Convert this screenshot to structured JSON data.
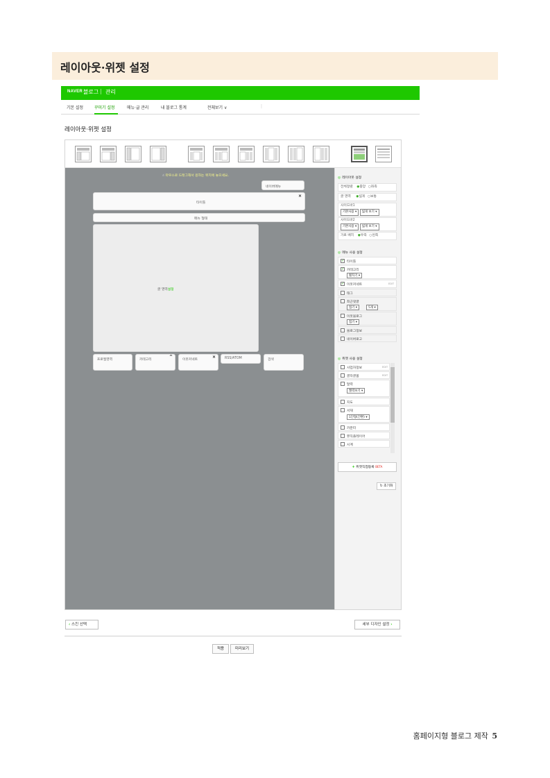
{
  "page_header": {
    "title": "레이아웃·위젯 설정"
  },
  "nav": {
    "brand": "NAVER",
    "blog": "블로그",
    "separator": "|",
    "admin": "관리"
  },
  "tabs": [
    {
      "label": "기본 설정"
    },
    {
      "label": "꾸미기 설정"
    },
    {
      "label": "메뉴·글 관리"
    },
    {
      "label": "내 블로그 통계"
    },
    {
      "label": "전체보기 ∨"
    }
  ],
  "section_title": "레이아웃·위젯 설정",
  "canvas": {
    "hint": "마우스로 드래그해서 원하는 위치에 놓으세요.",
    "blocks": {
      "network_menu": "네이버메뉴",
      "title": "타이틀",
      "menu_bar": "메뉴 형태",
      "post_area": "글 영역",
      "post_area_accent": "설정",
      "profile": "프로필영역",
      "category": "카테고리",
      "neighbor": "이웃커넥트",
      "rss": "RSS/ATOM",
      "search": "검색"
    }
  },
  "sidebar": {
    "layout_settings": {
      "heading": "레이아웃 설정",
      "rows": [
        {
          "label": "전체정렬",
          "opt_on": "중앙",
          "opt_off": "좌측"
        },
        {
          "label": "글 영역",
          "opt_on": "넓게",
          "opt_off": "보통"
        },
        {
          "label": "사이드바1",
          "sel1": "기본사용",
          "sel2": "넓게 보기"
        },
        {
          "label": "사이드바2",
          "sel1": "기본사용",
          "sel2": "넓게 보기"
        },
        {
          "label": "가로 배치",
          "opt_on": "우측",
          "opt_off": "왼쪽"
        }
      ]
    },
    "menu_settings": {
      "heading": "메뉴 사용 설정",
      "items": [
        {
          "label": "타이틀",
          "checked": true
        },
        {
          "label": "카테고리",
          "sub": "펼치기",
          "checked": true
        },
        {
          "label": "이웃커넥트",
          "edit": "EDIT",
          "checked": true
        },
        {
          "label": "태그",
          "checked": false
        },
        {
          "label": "최근댓글",
          "sub1": "접기",
          "sub2": "5개",
          "checked": false
        },
        {
          "label": "이웃블로그",
          "sub": "접기",
          "checked": false
        },
        {
          "label": "블로그정보",
          "checked": false
        },
        {
          "label": "네이버로고",
          "checked": false
        }
      ]
    },
    "widget_settings": {
      "heading": "위젯 사용 설정",
      "items": [
        {
          "label": "사업자정보",
          "edit": "EDIT"
        },
        {
          "label": "글자글꼴",
          "edit": "EDIT"
        },
        {
          "label": "달력",
          "sub": "월력보기"
        },
        {
          "label": "지도"
        },
        {
          "label": "서재",
          "sub": "1단형(간편)"
        },
        {
          "label": "카운터"
        },
        {
          "label": "뮤직플레이어"
        },
        {
          "label": "시계"
        }
      ],
      "direct_register": "위젯직접등록",
      "beta": "BETA",
      "reset": "초기화"
    }
  },
  "buttons": {
    "skin": "스킨 선택",
    "detail_design": "세부 디자인 설정",
    "apply": "적용",
    "preview": "미리보기"
  },
  "footer": {
    "text": "홈페이지형 블로그 제작",
    "page_number": "5"
  }
}
